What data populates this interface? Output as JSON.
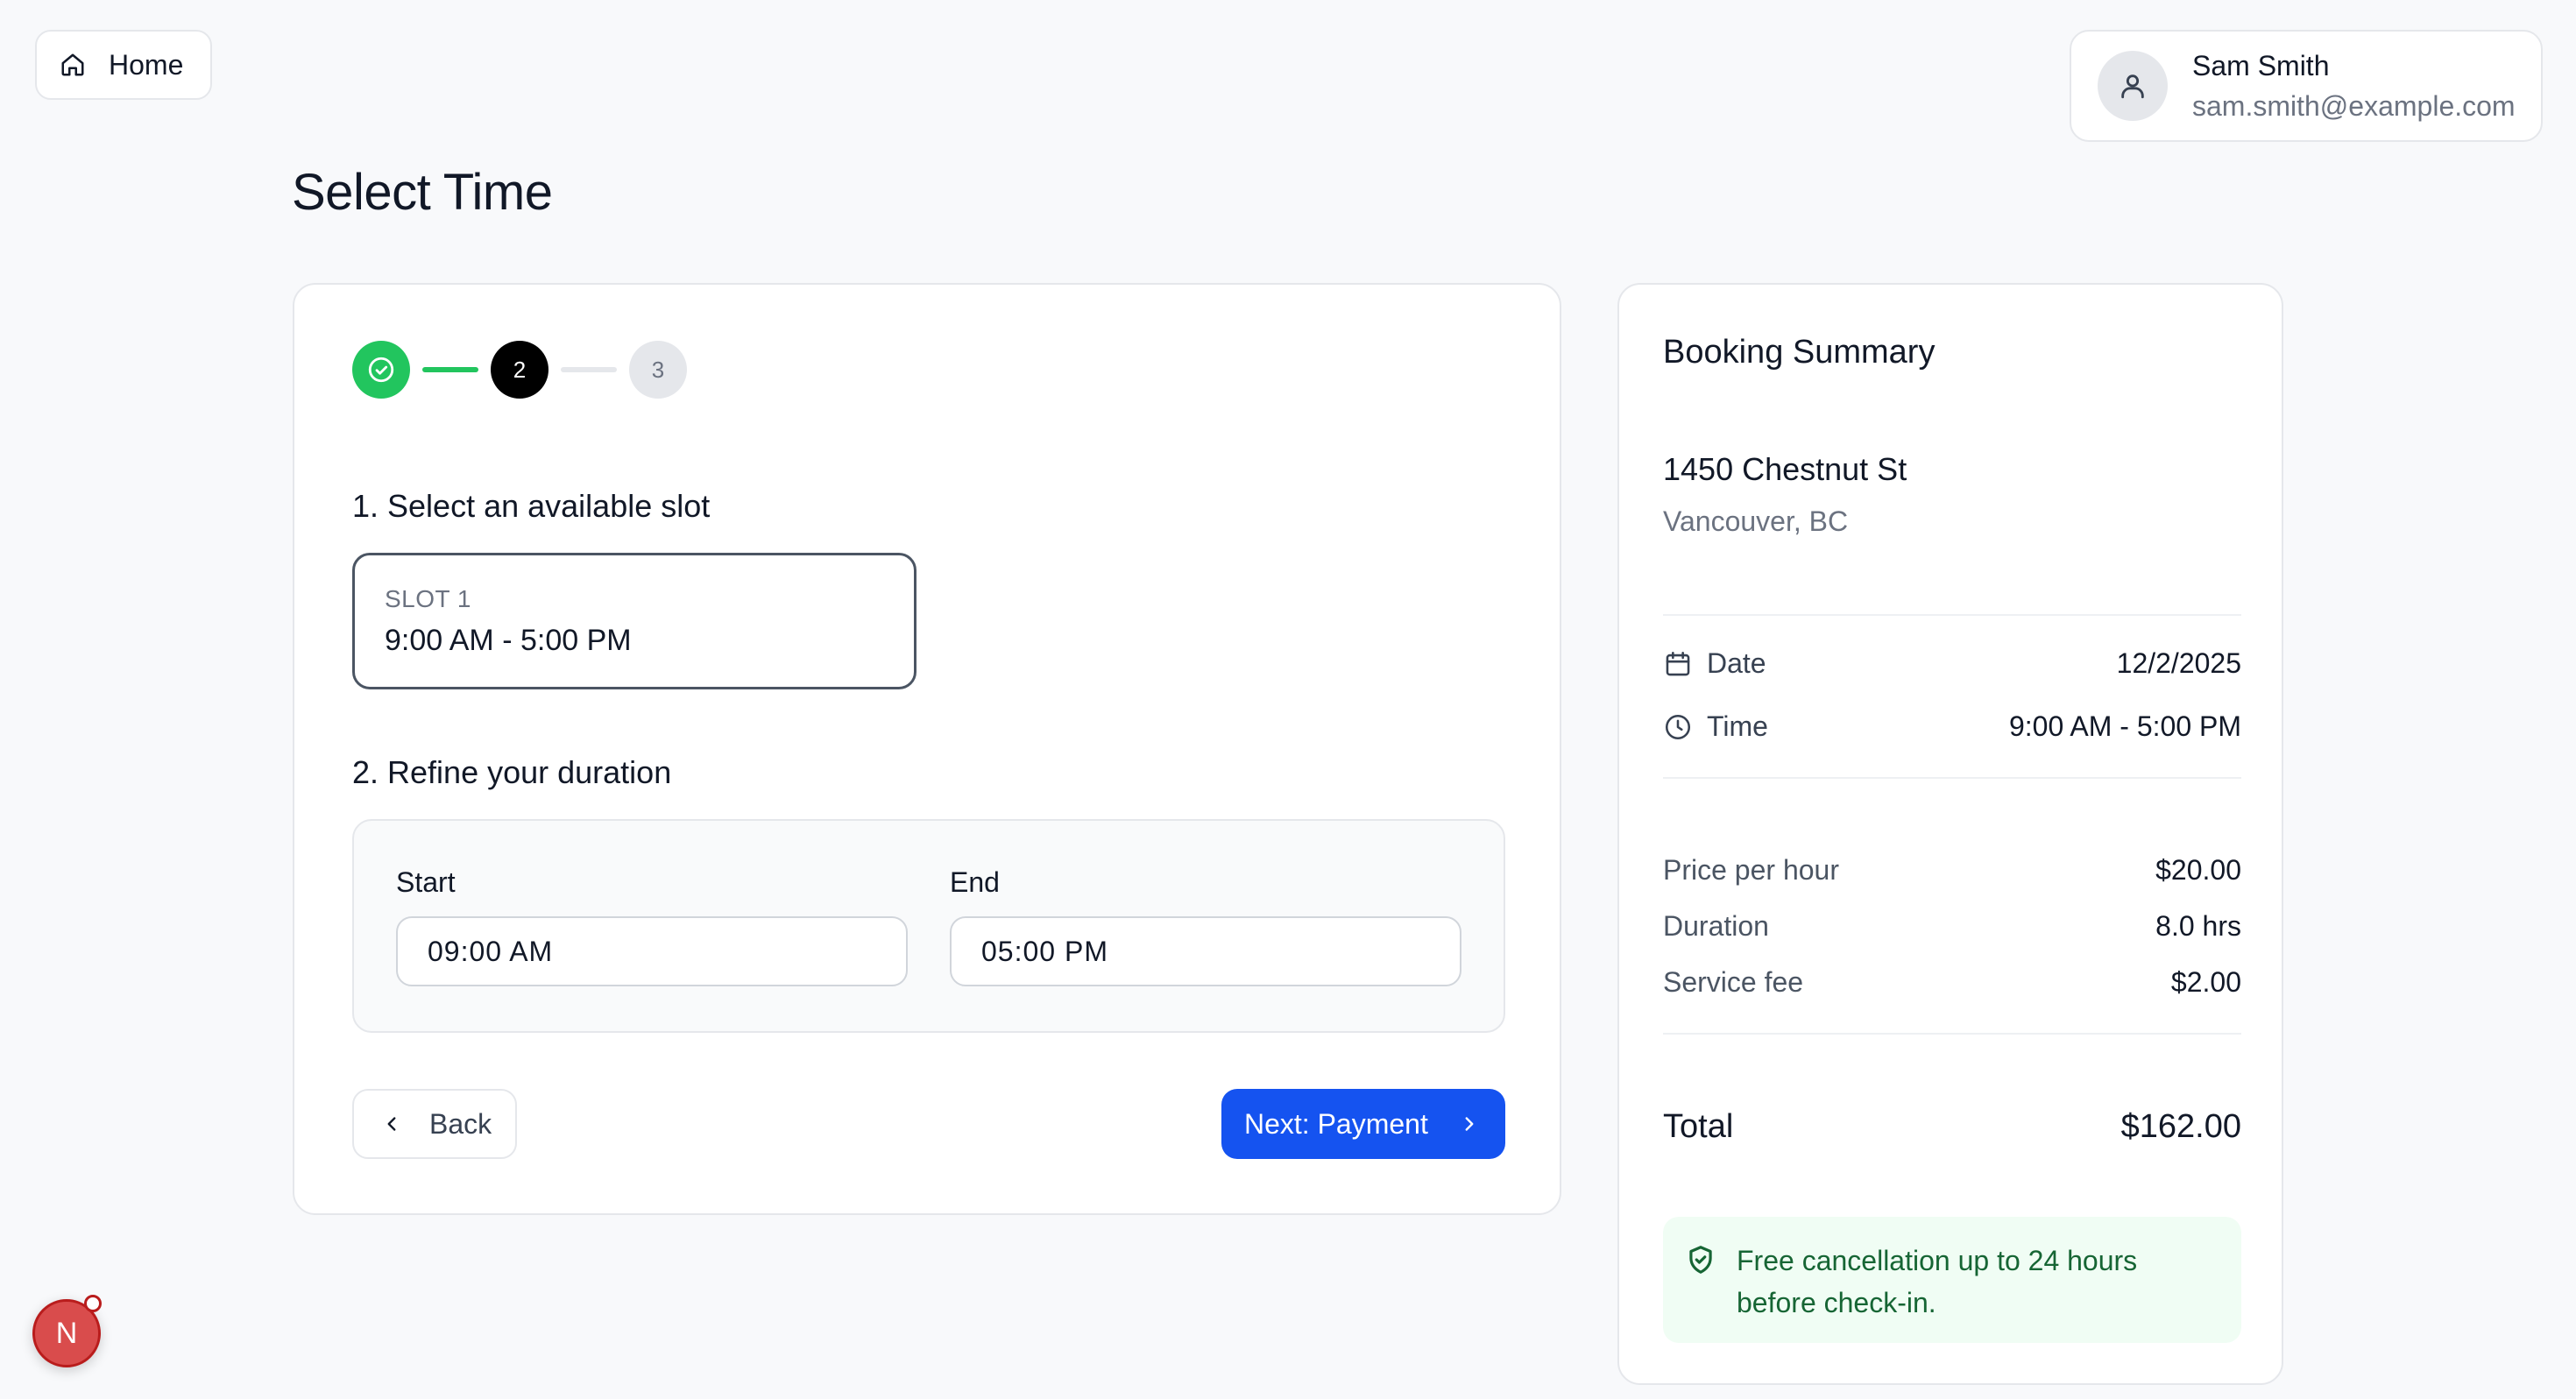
{
  "nav": {
    "home_label": "Home"
  },
  "user": {
    "name": "Sam Smith",
    "email": "sam.smith@example.com"
  },
  "page": {
    "title": "Select Time"
  },
  "stepper": {
    "steps": [
      {
        "number": "1",
        "status": "done"
      },
      {
        "number": "2",
        "status": "active"
      },
      {
        "number": "3",
        "status": "todo"
      }
    ]
  },
  "slots": {
    "heading": "1. Select an available slot",
    "items": [
      {
        "label": "SLOT 1",
        "time": "9:00 AM - 5:00 PM"
      }
    ]
  },
  "duration": {
    "heading": "2. Refine your duration",
    "start_label": "Start",
    "start_value": "09:00 AM",
    "end_label": "End",
    "end_value": "05:00 PM"
  },
  "actions": {
    "back_label": "Back",
    "next_label": "Next: Payment"
  },
  "summary": {
    "title": "Booking Summary",
    "address_line1": "1450 Chestnut St",
    "address_line2": "Vancouver, BC",
    "date_label": "Date",
    "date_value": "12/2/2025",
    "time_label": "Time",
    "time_value": "9:00 AM - 5:00 PM",
    "price_label": "Price per hour",
    "price_value": "$20.00",
    "duration_label": "Duration",
    "duration_value": "8.0 hrs",
    "fee_label": "Service fee",
    "fee_value": "$2.00",
    "total_label": "Total",
    "total_value": "$162.00",
    "notice_line1": "Free cancellation up to 24 hours",
    "notice_line2": "before check-in."
  },
  "badge": {
    "letter": "N"
  },
  "colors": {
    "primary": "#1553f0",
    "success": "#22c55e",
    "notice_bg": "#f0fdf4",
    "notice_text": "#166534",
    "background": "#f8f9fb"
  }
}
